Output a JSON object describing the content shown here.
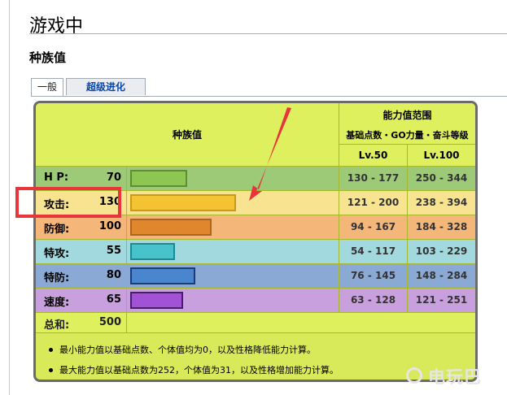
{
  "heading": "游戏中",
  "subheading": "种族值",
  "tabs": [
    {
      "label": "一般",
      "active": true
    },
    {
      "label": "超级进化",
      "active": false
    }
  ],
  "table": {
    "base_header": "种族值",
    "range_header": "能力值范围",
    "range_subheader": "基础点数・GO力量・奋斗等级",
    "col_lv50": "Lv.50",
    "col_lv100": "Lv.100",
    "stats": [
      {
        "label": "H P:",
        "value": "70",
        "bar_fraction": 0.28,
        "bar_color": "#8dc651",
        "bar_border": "#5f8f33",
        "row_color": "#9dca77",
        "range50": "130 - 177",
        "range100": "250 - 344"
      },
      {
        "label": "攻击:",
        "value": "130",
        "bar_fraction": 0.52,
        "bar_color": "#f5c231",
        "bar_border": "#c99a18",
        "row_color": "#f8e391",
        "range50": "121 - 200",
        "range100": "238 - 394"
      },
      {
        "label": "防御:",
        "value": "100",
        "bar_fraction": 0.4,
        "bar_color": "#e0872d",
        "bar_border": "#b0641a",
        "row_color": "#f5b679",
        "range50": "94 - 167",
        "range100": "184 - 328"
      },
      {
        "label": "特攻:",
        "value": "55",
        "bar_fraction": 0.22,
        "bar_color": "#48c3cc",
        "bar_border": "#1b8b92",
        "row_color": "#a2d9df",
        "range50": "54 - 117",
        "range100": "103 - 229"
      },
      {
        "label": "特防:",
        "value": "80",
        "bar_fraction": 0.32,
        "bar_color": "#4a86cf",
        "bar_border": "#183e7a",
        "row_color": "#8aaad5",
        "range50": "76 - 145",
        "range100": "148 - 284"
      },
      {
        "label": "速度:",
        "value": "65",
        "bar_fraction": 0.26,
        "bar_color": "#a152d5",
        "bar_border": "#4a1c6f",
        "row_color": "#c9a0de",
        "range50": "63 - 128",
        "range100": "121 - 251"
      }
    ],
    "total_label": "总和:",
    "total_value": "500"
  },
  "notes": [
    "最小能力值以基础点数、个体值均为0，以及性格降低能力计算。",
    "最大能力值以基础点数为252，个体值为31，以及性格增加能力计算。"
  ],
  "watermark": "电玩巴"
}
